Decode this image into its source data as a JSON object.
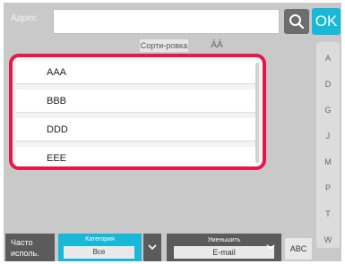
{
  "header": {
    "address_placeholder": "Адрес",
    "ok_label": "OK",
    "sort_label": "Сорти-ровка",
    "sort_icon_glyph": "ĀĀ"
  },
  "list": {
    "items": [
      "AAA",
      "BBB",
      "DDD",
      "EEE"
    ]
  },
  "alpha_index": {
    "letters": [
      "A",
      "D",
      "G",
      "J",
      "M",
      "P",
      "T",
      "W"
    ]
  },
  "bottom": {
    "freq_label_line1": "Часто",
    "freq_label_line2": "исполь.",
    "category_label": "Категория",
    "category_value": "Все",
    "narrow_label": "Уменьшить",
    "narrow_value": "E-mail",
    "abc_label": "ABC"
  },
  "colors": {
    "accent": "#19b8d8",
    "highlight": "#e5174b",
    "dark": "#5b5b5b"
  }
}
